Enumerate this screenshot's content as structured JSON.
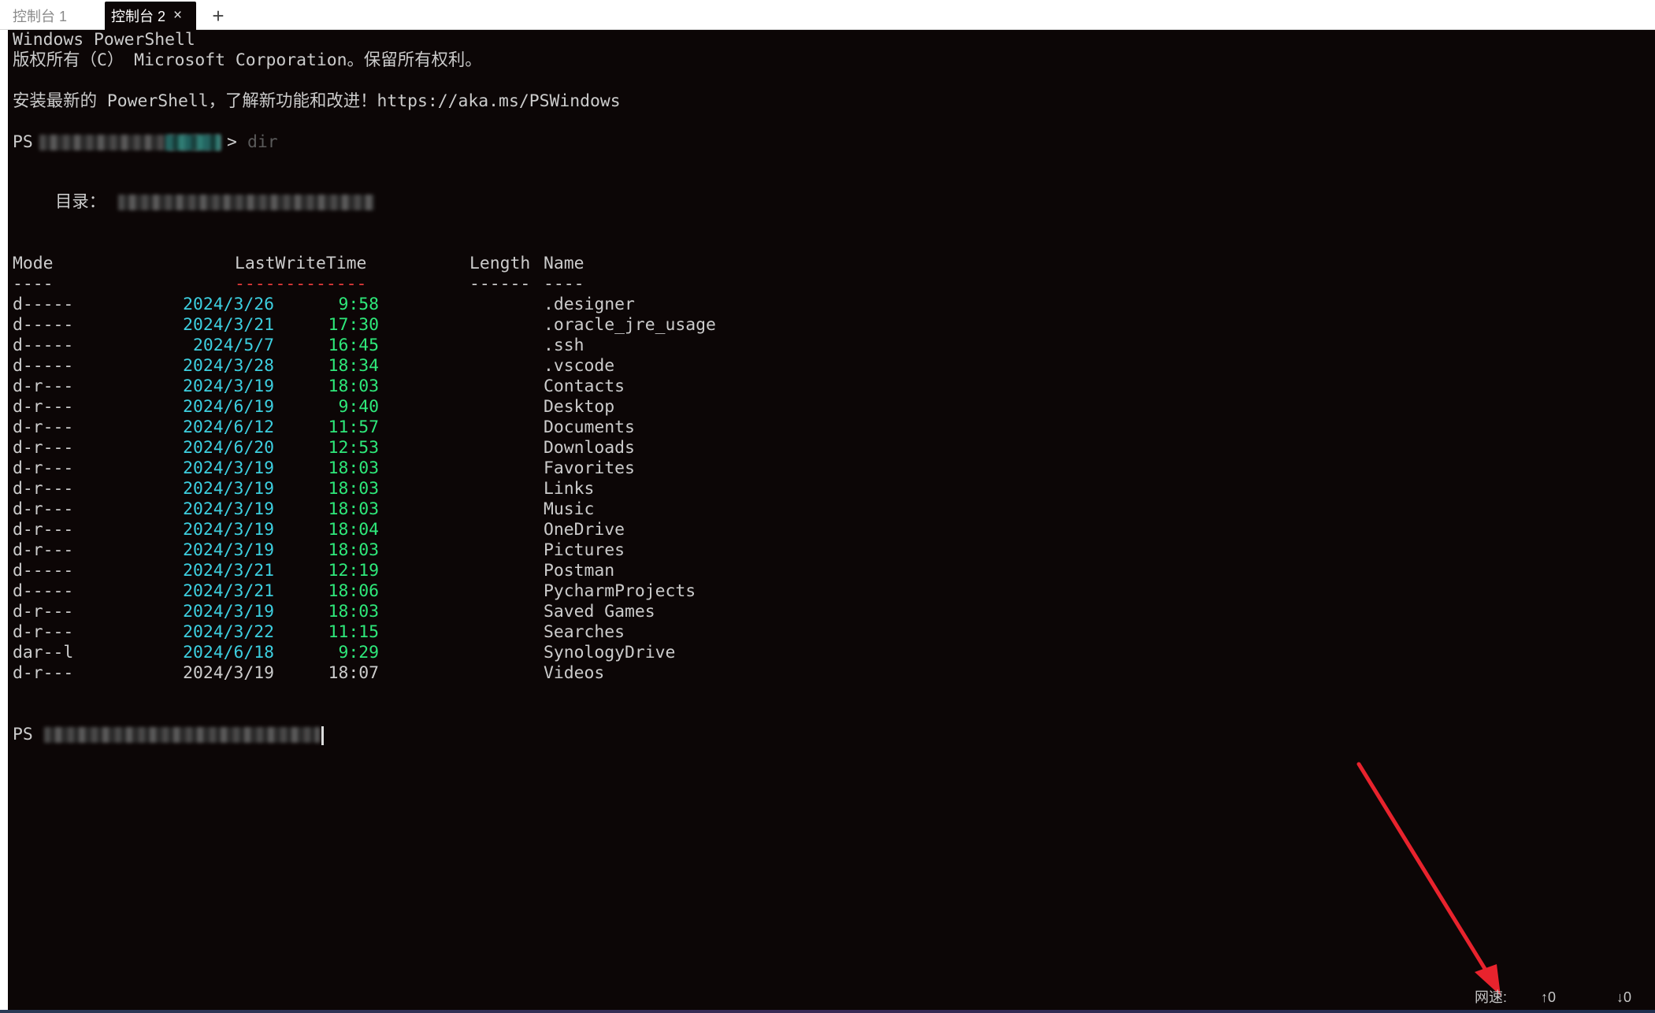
{
  "tabs": [
    {
      "label": "控制台 1",
      "active": false
    },
    {
      "label": "控制台 2",
      "active": true,
      "close": "×"
    }
  ],
  "new_tab": "+",
  "header": {
    "line1": "Windows PowerShell",
    "line2": "版权所有（C） Microsoft Corporation。保留所有权利。",
    "line3": "安装最新的 PowerShell，了解新功能和改进！https://aka.ms/PSWindows"
  },
  "prompt1": {
    "ps": "PS",
    "gt": ">",
    "command": "dir"
  },
  "directory_label": "目录：",
  "table": {
    "headers": {
      "mode": "Mode",
      "time": "LastWriteTime",
      "length": "Length",
      "name": "Name"
    },
    "underlines": {
      "mode": "----",
      "time": "-------------",
      "length": "------",
      "name": "----"
    },
    "rows": [
      {
        "mode": "d-----",
        "date": "2024/3/26",
        "time": "9:58",
        "name": ".designer"
      },
      {
        "mode": "d-----",
        "date": "2024/3/21",
        "time": "17:30",
        "name": ".oracle_jre_usage"
      },
      {
        "mode": "d-----",
        "date": "2024/5/7",
        "time": "16:45",
        "name": ".ssh"
      },
      {
        "mode": "d-----",
        "date": "2024/3/28",
        "time": "18:34",
        "name": ".vscode"
      },
      {
        "mode": "d-r---",
        "date": "2024/3/19",
        "time": "18:03",
        "name": "Contacts"
      },
      {
        "mode": "d-r---",
        "date": "2024/6/19",
        "time": "9:40",
        "name": "Desktop"
      },
      {
        "mode": "d-r---",
        "date": "2024/6/12",
        "time": "11:57",
        "name": "Documents"
      },
      {
        "mode": "d-r---",
        "date": "2024/6/20",
        "time": "12:53",
        "name": "Downloads"
      },
      {
        "mode": "d-r---",
        "date": "2024/3/19",
        "time": "18:03",
        "name": "Favorites"
      },
      {
        "mode": "d-r---",
        "date": "2024/3/19",
        "time": "18:03",
        "name": "Links"
      },
      {
        "mode": "d-r---",
        "date": "2024/3/19",
        "time": "18:03",
        "name": "Music"
      },
      {
        "mode": "d-r---",
        "date": "2024/3/19",
        "time": "18:04",
        "name": "OneDrive"
      },
      {
        "mode": "d-r---",
        "date": "2024/3/19",
        "time": "18:03",
        "name": "Pictures"
      },
      {
        "mode": "d-----",
        "date": "2024/3/21",
        "time": "12:19",
        "name": "Postman"
      },
      {
        "mode": "d-----",
        "date": "2024/3/21",
        "time": "18:06",
        "name": "PycharmProjects"
      },
      {
        "mode": "d-r---",
        "date": "2024/3/19",
        "time": "18:03",
        "name": "Saved Games"
      },
      {
        "mode": "d-r---",
        "date": "2024/3/22",
        "time": "11:15",
        "name": "Searches"
      },
      {
        "mode": "dar--l",
        "date": "2024/6/18",
        "time": "9:29",
        "name": "SynologyDrive"
      },
      {
        "mode": "d-r---",
        "date": "2024/3/19",
        "time": "18:07",
        "name": "Videos"
      }
    ]
  },
  "prompt2": {
    "ps": "PS"
  },
  "status": {
    "label": "网速:",
    "up": "↑0",
    "down": "↓0"
  },
  "colors": {
    "background": "#0c0606",
    "text": "#cccccc",
    "date": "#3dcfe0",
    "time": "#2ee87a",
    "underline_accent": "#e83a3a",
    "arrow": "#e8232d"
  }
}
